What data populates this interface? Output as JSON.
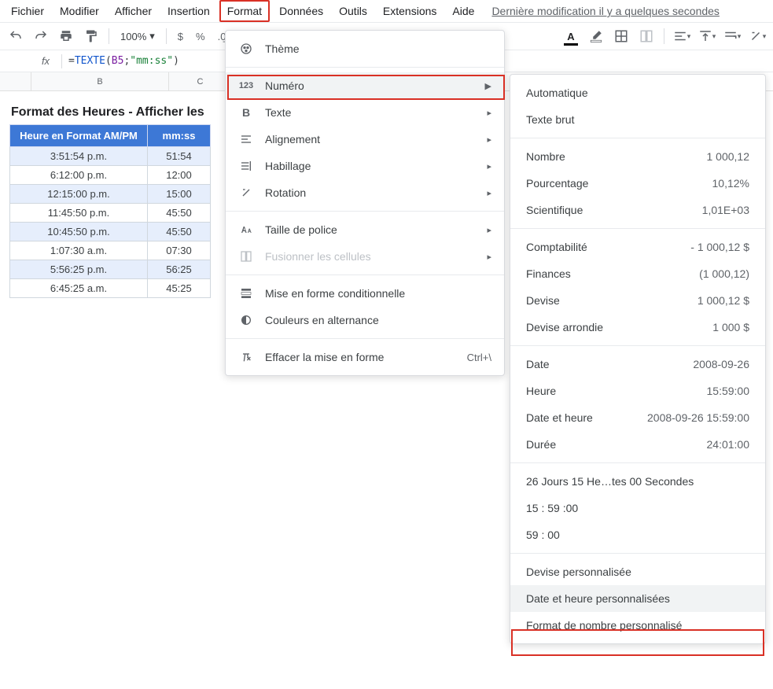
{
  "menubar": [
    "Fichier",
    "Modifier",
    "Afficher",
    "Insertion",
    "Format",
    "Données",
    "Outils",
    "Extensions",
    "Aide"
  ],
  "last_edit": "Dernière modification il y a quelques secondes",
  "toolbar": {
    "zoom": "100%"
  },
  "formula": {
    "fn": "TEXTE",
    "ref": "B5",
    "str": "\"mm:ss\""
  },
  "columns": {
    "b": "B",
    "c": "C"
  },
  "sheet_title": "Format des Heures - Afficher les",
  "table": {
    "headers": {
      "ampm": "Heure en Format AM/PM",
      "mmss": "mm:ss"
    },
    "rows": [
      {
        "ampm": "3:51:54 p.m.",
        "mmss": "51:54"
      },
      {
        "ampm": "6:12:00 p.m.",
        "mmss": "12:00"
      },
      {
        "ampm": "12:15:00 p.m.",
        "mmss": "15:00"
      },
      {
        "ampm": "11:45:50 p.m.",
        "mmss": "45:50"
      },
      {
        "ampm": "10:45:50 p.m.",
        "mmss": "45:50"
      },
      {
        "ampm": "1:07:30 a.m.",
        "mmss": "07:30"
      },
      {
        "ampm": "5:56:25 p.m.",
        "mmss": "56:25"
      },
      {
        "ampm": "6:45:25 a.m.",
        "mmss": "45:25"
      }
    ]
  },
  "format_menu": {
    "theme": "Thème",
    "numero": "Numéro",
    "texte": "Texte",
    "alignement": "Alignement",
    "habillage": "Habillage",
    "rotation": "Rotation",
    "taille_police": "Taille de police",
    "fusionner": "Fusionner les cellules",
    "mise_forme_cond": "Mise en forme conditionnelle",
    "couleurs_alt": "Couleurs en alternance",
    "effacer": "Effacer la mise en forme",
    "effacer_sc": "Ctrl+\\"
  },
  "number_submenu": {
    "auto": "Automatique",
    "brut": "Texte brut",
    "nombre": {
      "label": "Nombre",
      "sample": "1 000,12"
    },
    "pct": {
      "label": "Pourcentage",
      "sample": "10,12%"
    },
    "sci": {
      "label": "Scientifique",
      "sample": "1,01E+03"
    },
    "compta": {
      "label": "Comptabilité",
      "sample": "- 1 000,12 $"
    },
    "fin": {
      "label": "Finances",
      "sample": "(1 000,12)"
    },
    "devise": {
      "label": "Devise",
      "sample": "1 000,12 $"
    },
    "devise_arr": {
      "label": "Devise arrondie",
      "sample": "1 000 $"
    },
    "date": {
      "label": "Date",
      "sample": "2008-09-26"
    },
    "heure": {
      "label": "Heure",
      "sample": "15:59:00"
    },
    "date_heure": {
      "label": "Date et heure",
      "sample": "2008-09-26 15:59:00"
    },
    "duree": {
      "label": "Durée",
      "sample": "24:01:00"
    },
    "custom1": "26 Jours 15 He…tes 00 Secondes",
    "custom2": "15 : 59 :00",
    "custom3": "59 : 00",
    "devise_perso": "Devise personnalisée",
    "date_perso": "Date et heure personnalisées",
    "nombre_perso": "Format de nombre personnalisé"
  }
}
